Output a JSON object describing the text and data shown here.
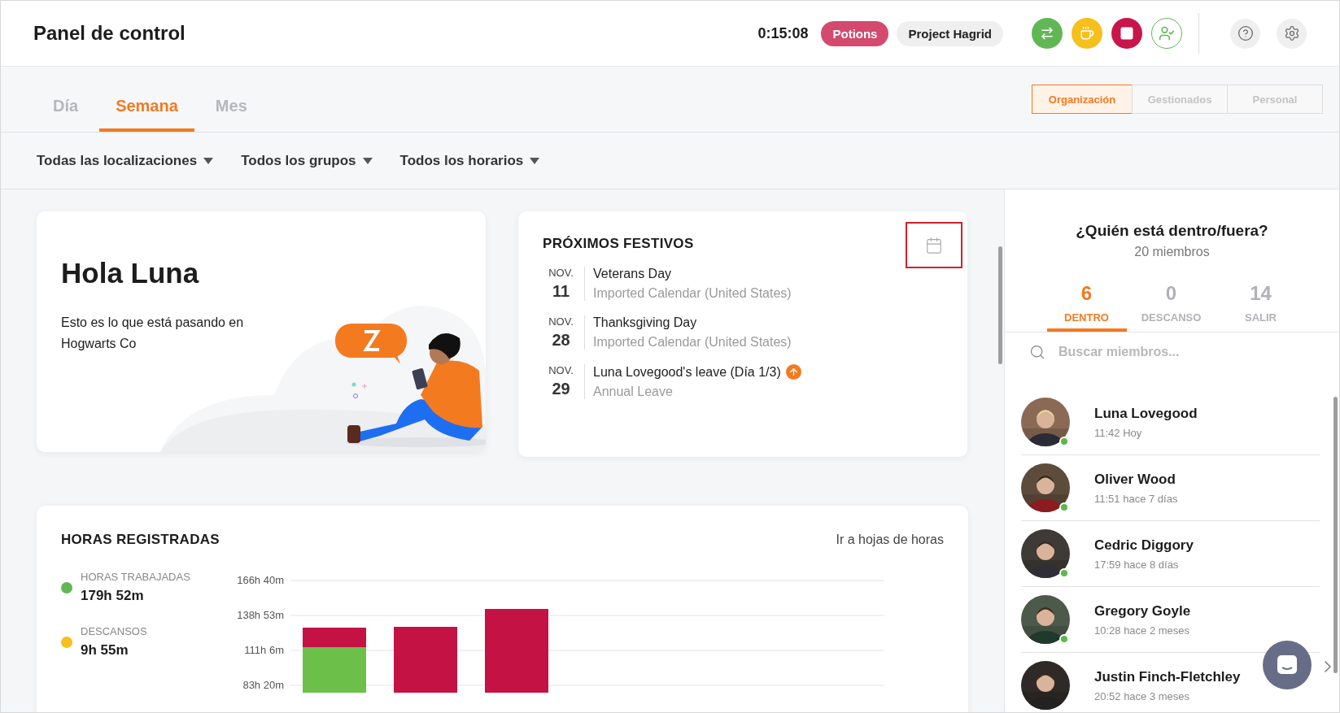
{
  "header": {
    "title": "Panel de control",
    "timer": "0:15:08",
    "tags": [
      {
        "label": "Potions",
        "kind": "active"
      },
      {
        "label": "Project Hagrid",
        "kind": "plain"
      }
    ],
    "actions": [
      {
        "kind": "switch",
        "color": "#62b755"
      },
      {
        "kind": "break",
        "color": "#f7bf1b"
      },
      {
        "kind": "stop",
        "color": "#c8154a"
      },
      {
        "kind": "person",
        "color": "#62b755"
      }
    ],
    "tools": [
      {
        "kind": "help"
      },
      {
        "kind": "settings"
      }
    ]
  },
  "tabs": [
    {
      "label": "Día",
      "selected": false
    },
    {
      "label": "Semana",
      "selected": true
    },
    {
      "label": "Mes",
      "selected": false
    }
  ],
  "scope": [
    {
      "label": "Organización",
      "selected": true
    },
    {
      "label": "Gestionados",
      "selected": false
    },
    {
      "label": "Personal",
      "selected": false
    }
  ],
  "filters": [
    "Todas las localizaciones",
    "Todos los grupos",
    "Todos los horarios"
  ],
  "greeting": {
    "title": "Hola Luna",
    "text": "Esto es lo que está pasando en Hogwarts Co"
  },
  "holidays": {
    "title": "PRÓXIMOS FESTIVOS",
    "items": [
      {
        "month": "NOV.",
        "day": "11",
        "name": "Veterans Day",
        "source": "Imported Calendar (United States)",
        "flag": false
      },
      {
        "month": "NOV.",
        "day": "28",
        "name": "Thanksgiving Day",
        "source": "Imported Calendar (United States)",
        "flag": false
      },
      {
        "month": "NOV.",
        "day": "29",
        "name": "Luna Lovegood's leave (Día 1/3)",
        "source": "Annual Leave",
        "flag": true
      }
    ]
  },
  "hours": {
    "title": "HORAS REGISTRADAS",
    "link": "Ir a hojas de horas",
    "legend": [
      {
        "label": "HORAS TRABAJADAS",
        "value": "179h 52m",
        "color": "#62b755"
      },
      {
        "label": "DESCANSOS",
        "value": "9h 55m",
        "color": "#f7bf1b"
      }
    ],
    "y_axis": [
      "166h 40m",
      "138h 53m",
      "111h 6m",
      "83h 20m"
    ]
  },
  "presence": {
    "title": "¿Quién está dentro/fuera?",
    "count": "20 miembros",
    "tabs": [
      {
        "value": "6",
        "label": "DENTRO",
        "selected": true
      },
      {
        "value": "0",
        "label": "DESCANSO",
        "selected": false
      },
      {
        "value": "14",
        "label": "SALIR",
        "selected": false
      }
    ],
    "search": {
      "placeholder": "Buscar miembros..."
    },
    "members": [
      {
        "name": "Luna Lovegood",
        "time": "11:42 Hoy",
        "online": true
      },
      {
        "name": "Oliver Wood",
        "time": "11:51 hace 7 días",
        "online": true
      },
      {
        "name": "Cedric Diggory",
        "time": "17:59 hace 8 días",
        "online": true
      },
      {
        "name": "Gregory Goyle",
        "time": "10:28 hace 2 meses",
        "online": true
      },
      {
        "name": "Justin Finch-Fletchley",
        "time": "20:52 hace 3 meses",
        "online": false
      }
    ]
  }
}
